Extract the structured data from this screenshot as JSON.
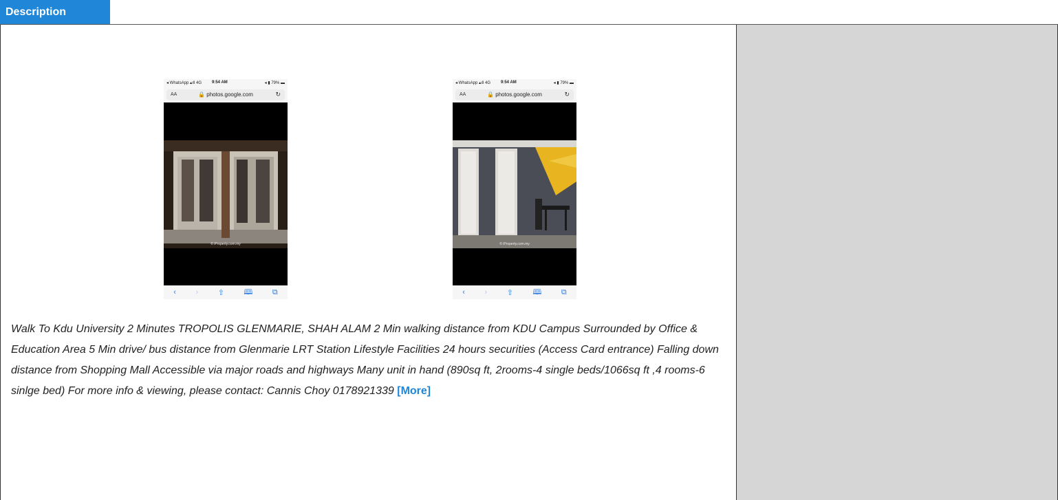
{
  "header": {
    "tab_label": "Description"
  },
  "phones": [
    {
      "status_left": "◂ WhatsApp ▴ıll 4G",
      "status_time": "9:54 AM",
      "status_right": "◂ ▮ 79% ▬",
      "aa": "AA",
      "url": "🔒 photos.google.com",
      "reload": "↻",
      "watermark": "© iProperty.com.my"
    },
    {
      "status_left": "◂ WhatsApp ▴ıll 4G",
      "status_time": "9:54 AM",
      "status_right": "◂ ▮ 79% ▬",
      "aa": "AA",
      "url": "🔒 photos.google.com",
      "reload": "↻",
      "watermark": "© iProperty.com.my"
    }
  ],
  "toolbar_icons": [
    "chevron-left-icon",
    "chevron-right-icon",
    "share-icon",
    "bookmarks-icon",
    "tabs-icon"
  ],
  "description": {
    "text": "Walk To Kdu University 2 Minutes  TROPOLIS GLENMARIE, SHAH ALAM    2 Min walking distance from KDU Campus  Surrounded by Office & Education Area 5 Min drive/ bus distance from Glenmarie LRT Station Lifestyle Facilities 24 hours securities (Access Card entrance) Falling down distance from Shopping Mall Accessible via major roads and highways  Many unit in hand (890sq ft, 2rooms-4 single beds/1066sq ft ,4 rooms-6 sinlge bed)   For more info & viewing, please contact:  Cannis Choy 0178921339",
    "more_label": "[More]"
  },
  "colors": {
    "accent": "#1f86d8",
    "sidebar": "#d6d6d6"
  }
}
